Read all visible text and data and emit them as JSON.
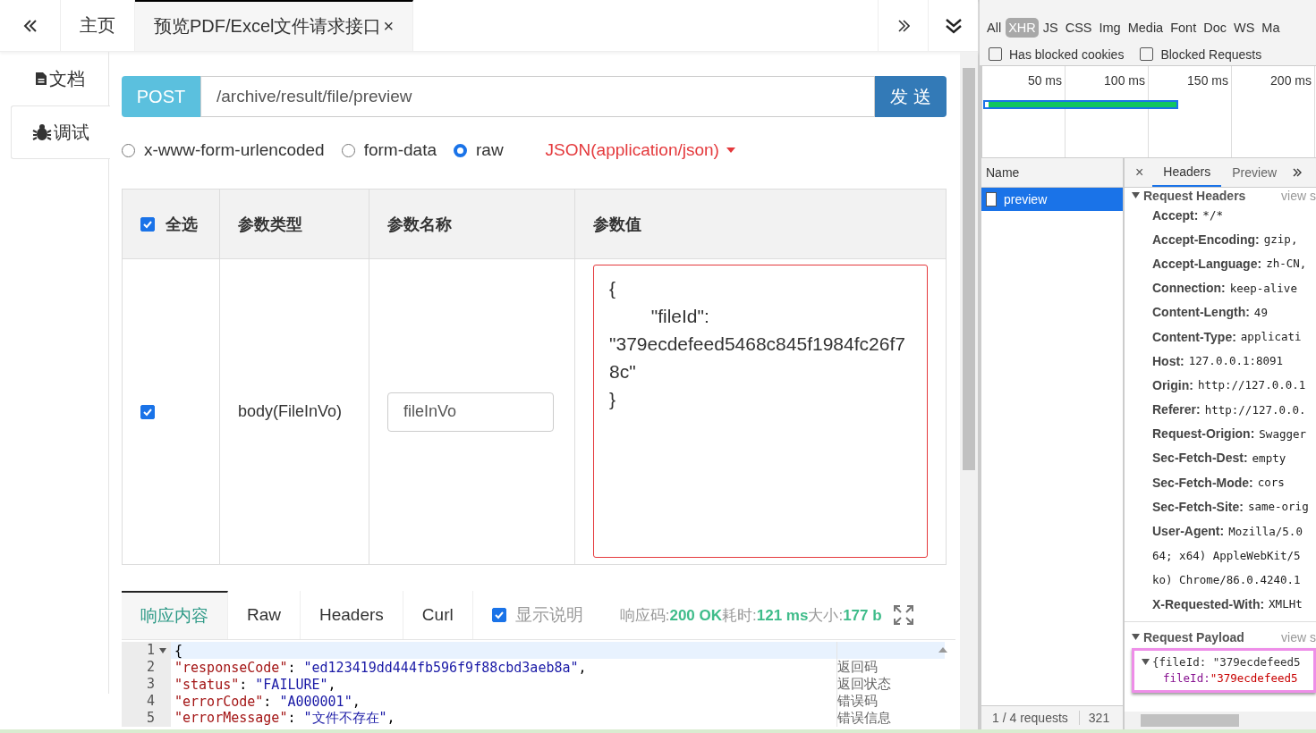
{
  "tabs": [
    {
      "label": "主页",
      "selected": false,
      "closable": false
    },
    {
      "label": "预览PDF/Excel文件请求接口",
      "selected": true,
      "closable": true,
      "close": "×"
    }
  ],
  "sidebar": [
    {
      "label": "文档",
      "selected": false
    },
    {
      "label": "调试",
      "selected": true
    }
  ],
  "request": {
    "method": "POST",
    "url": "/archive/result/file/preview",
    "send": "发 送"
  },
  "body_types": [
    {
      "label": "x-www-form-urlencoded",
      "selected": false
    },
    {
      "label": "form-data",
      "selected": false
    },
    {
      "label": "raw",
      "selected": true
    }
  ],
  "content_type": "JSON(application/json)",
  "params": {
    "columns": [
      {
        "label": "全选",
        "kind": "checkbox",
        "checked": true
      },
      {
        "label": "参数类型",
        "kind": "text"
      },
      {
        "label": "参数名称",
        "kind": "text"
      },
      {
        "label": "参数值",
        "kind": "text"
      }
    ],
    "rows": [
      {
        "checked": true,
        "type": "body(FileInVo)",
        "name": "fileInVo",
        "value": "{\n        \"fileId\": \"379ecdefeed5468c845f1984fc26f78c\"\n}"
      }
    ]
  },
  "response": {
    "tabs": [
      {
        "label": "响应内容",
        "selected": true
      },
      {
        "label": "Raw",
        "selected": false
      },
      {
        "label": "Headers",
        "selected": false
      },
      {
        "label": "Curl",
        "selected": false
      }
    ],
    "show_notes": {
      "label": "显示说明",
      "checked": true
    },
    "status": [
      {
        "kind": "label",
        "text": "响应码:"
      },
      {
        "kind": "value",
        "text": "200 OK"
      },
      {
        "kind": "label",
        "text": "耗时:"
      },
      {
        "kind": "value",
        "text": "121 ms"
      },
      {
        "kind": "label",
        "text": "大小:"
      },
      {
        "kind": "value",
        "text": "177 b"
      }
    ],
    "lines": [
      {
        "number": "1",
        "fold": true,
        "tokens": [
          {
            "kind": "punct",
            "text": "{"
          }
        ]
      },
      {
        "number": "2",
        "fold": false,
        "tokens": [
          {
            "kind": "key",
            "text": "\"responseCode\""
          },
          {
            "kind": "punct",
            "text": ": "
          },
          {
            "kind": "string",
            "text": "\"ed123419dd444fb596f9f88cbd3aeb8a\""
          },
          {
            "kind": "punct",
            "text": ","
          }
        ],
        "note": "返回码"
      },
      {
        "number": "3",
        "fold": false,
        "tokens": [
          {
            "kind": "key",
            "text": "\"status\""
          },
          {
            "kind": "punct",
            "text": ": "
          },
          {
            "kind": "string",
            "text": "\"FAILURE\""
          },
          {
            "kind": "punct",
            "text": ","
          }
        ],
        "note": "返回状态"
      },
      {
        "number": "4",
        "fold": false,
        "tokens": [
          {
            "kind": "key",
            "text": "\"errorCode\""
          },
          {
            "kind": "punct",
            "text": ": "
          },
          {
            "kind": "string",
            "text": "\"A000001\""
          },
          {
            "kind": "punct",
            "text": ","
          }
        ],
        "note": "错误码"
      },
      {
        "number": "5",
        "fold": false,
        "tokens": [
          {
            "kind": "key",
            "text": "\"errorMessage\""
          },
          {
            "kind": "punct",
            "text": ": "
          },
          {
            "kind": "string",
            "text": "\"文件不存在\""
          },
          {
            "kind": "punct",
            "text": ","
          }
        ],
        "note": "错误信息"
      }
    ]
  },
  "devtools": {
    "type_filters": [
      {
        "label": "All",
        "selected": false
      },
      {
        "label": "XHR",
        "selected": true
      },
      {
        "label": "JS",
        "selected": false
      },
      {
        "label": "CSS",
        "selected": false
      },
      {
        "label": "Img",
        "selected": false
      },
      {
        "label": "Media",
        "selected": false
      },
      {
        "label": "Font",
        "selected": false
      },
      {
        "label": "Doc",
        "selected": false
      },
      {
        "label": "WS",
        "selected": false
      },
      {
        "label": "Ma",
        "selected": false
      }
    ],
    "options": [
      {
        "label": "Has blocked cookies",
        "checked": false
      },
      {
        "label": "Blocked Requests",
        "checked": false
      }
    ],
    "timeline_ticks": [
      "50 ms",
      "100 ms",
      "150 ms",
      "200 ms"
    ],
    "name_header": "Name",
    "requests": [
      {
        "name": "preview",
        "selected": true
      }
    ],
    "footer": [
      "1 / 4 requests",
      "321"
    ],
    "close": "×",
    "detail_tabs": [
      {
        "label": "Headers",
        "selected": true
      },
      {
        "label": "Preview",
        "selected": false
      }
    ],
    "request_headers": {
      "title": "Request Headers",
      "expanded": true,
      "view": "view s",
      "items": [
        {
          "name": "Accept:",
          "lines": [
            "*/*"
          ]
        },
        {
          "name": "Accept-Encoding:",
          "lines": [
            "gzip,"
          ]
        },
        {
          "name": "Accept-Language:",
          "lines": [
            "zh-CN,"
          ]
        },
        {
          "name": "Connection:",
          "lines": [
            "keep-alive"
          ]
        },
        {
          "name": "Content-Length:",
          "lines": [
            "49"
          ]
        },
        {
          "name": "Content-Type:",
          "lines": [
            "applicati"
          ]
        },
        {
          "name": "Host:",
          "lines": [
            "127.0.0.1:8091"
          ]
        },
        {
          "name": "Origin:",
          "lines": [
            "http://127.0.0.1"
          ]
        },
        {
          "name": "Referer:",
          "lines": [
            "http://127.0.0."
          ]
        },
        {
          "name": "Request-Origion:",
          "lines": [
            "Swagger"
          ]
        },
        {
          "name": "Sec-Fetch-Dest:",
          "lines": [
            "empty"
          ]
        },
        {
          "name": "Sec-Fetch-Mode:",
          "lines": [
            "cors"
          ]
        },
        {
          "name": "Sec-Fetch-Site:",
          "lines": [
            "same-orig"
          ]
        },
        {
          "name": "User-Agent:",
          "lines": [
            "Mozilla/5.0",
            "64; x64) AppleWebKit/5",
            "ko) Chrome/86.0.4240.1"
          ]
        },
        {
          "name": "X-Requested-With:",
          "lines": [
            "XMLHt"
          ]
        }
      ]
    },
    "payload": {
      "title": "Request Payload",
      "expanded": true,
      "view": "view s",
      "summary": "{fileId: \"379ecdefeed5",
      "key": "fileId:",
      "value": "\"379ecdefeed5"
    }
  }
}
